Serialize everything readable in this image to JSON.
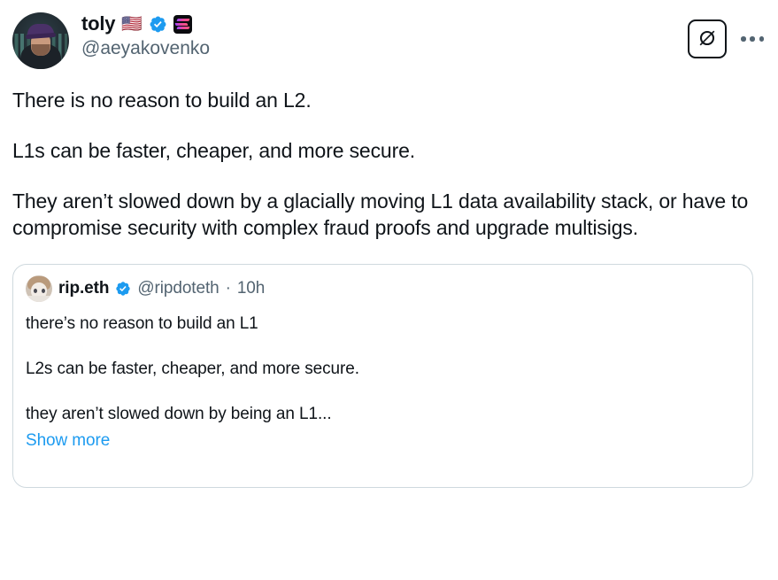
{
  "post": {
    "author": {
      "display_name": "toly",
      "handle": "@aeyakovenko",
      "flag_emoji": "🇺🇸",
      "verified": true,
      "affiliate_badge": "solana-logo",
      "avatar": "toly-avatar"
    },
    "actions": {
      "grok_icon": "grok-icon",
      "more_label": "More"
    },
    "paragraphs": [
      "There is no reason to build an L2.",
      "L1s can be faster, cheaper, and more secure.",
      "They aren’t slowed down by a glacially moving L1 data availability stack, or have to compromise security with complex fraud proofs and upgrade multisigs."
    ]
  },
  "quoted_post": {
    "author": {
      "display_name": "rip.eth",
      "handle": "@ripdoteth",
      "verified": true,
      "avatar": "rip-avatar"
    },
    "separator": "·",
    "timestamp": "10h",
    "paragraphs": [
      "there’s no reason to build an L1",
      "L2s can be faster, cheaper, and more secure.",
      "they aren’t slowed down by being an L1..."
    ],
    "show_more_label": "Show more"
  },
  "colors": {
    "text_primary": "#0f1419",
    "text_secondary": "#536471",
    "link_blue": "#1d9bf0",
    "verified_blue": "#1d9bf0",
    "card_border": "#cfd9de",
    "background": "#ffffff"
  }
}
